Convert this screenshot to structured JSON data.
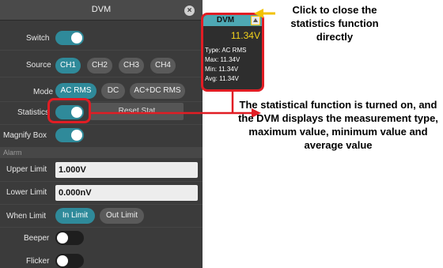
{
  "panel": {
    "title": "DVM",
    "close_glyph": "×",
    "switch_label": "Switch",
    "switch_state": "on",
    "source_label": "Source",
    "sources": [
      "CH1",
      "CH2",
      "CH3",
      "CH4"
    ],
    "source_selected": "CH1",
    "mode_label": "Mode",
    "modes": [
      "AC RMS",
      "DC",
      "AC+DC RMS"
    ],
    "mode_selected": "AC RMS",
    "statistics_label": "Statistics",
    "statistics_state": "on",
    "reset_stat_label": "Reset Stat",
    "magnify_label": "Magnify Box",
    "magnify_state": "on",
    "alarm_section": "Alarm",
    "upper_limit_label": "Upper Limit",
    "upper_limit_value": "1.000V",
    "lower_limit_label": "Lower Limit",
    "lower_limit_value": "0.000nV",
    "when_limit_label": "When Limit",
    "when_limit_options": [
      "In Limit",
      "Out Limit"
    ],
    "when_limit_selected": "In Limit",
    "beeper_label": "Beeper",
    "beeper_state": "off",
    "flicker_label": "Flicker",
    "flicker_state": "off"
  },
  "stat_window": {
    "title": "DVM",
    "reading": "11.34V",
    "type_line": "Type: AC RMS",
    "max_line": "Max: 11.34V",
    "min_line": "Min: 11.34V",
    "avg_line": "Avg: 11.34V"
  },
  "annotations": {
    "close_callout": "Click to close the statistics function directly",
    "stat_callout": "The statistical function is turned on, and the DVM displays the measurement type, maximum value, minimum value and average value",
    "callout_color": "#e11d24",
    "close_arrow_color": "#f2c200"
  },
  "colors": {
    "accent": "#2f8a9a",
    "panel_bg": "#3b3b3b",
    "stat_header": "#4ea8b4",
    "reading": "#f3d31c"
  }
}
